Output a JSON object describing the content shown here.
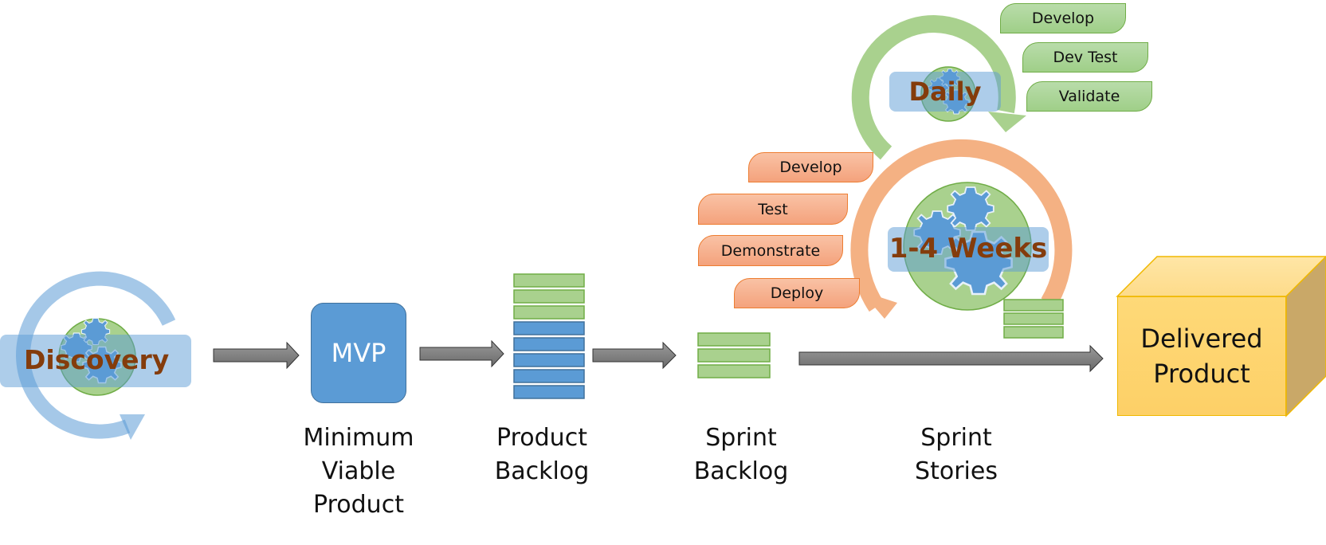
{
  "diagram": {
    "discovery": {
      "label": "Discovery"
    },
    "mvp": {
      "box_label": "MVP",
      "caption": [
        "Minimum",
        "Viable",
        "Product"
      ]
    },
    "product_backlog": {
      "caption": [
        "Product",
        "Backlog"
      ],
      "green_items": 3,
      "blue_items": 5
    },
    "sprint_backlog": {
      "caption": [
        "Sprint",
        "Backlog"
      ],
      "items": 3
    },
    "sprint_stories": {
      "caption": [
        "Sprint",
        "Stories"
      ],
      "items": 3
    },
    "daily_cycle": {
      "label": "Daily",
      "steps": [
        "Develop",
        "Dev Test",
        "Validate"
      ]
    },
    "sprint_cycle": {
      "label": "1-4 Weeks",
      "steps": [
        "Develop",
        "Test",
        "Demonstrate",
        "Deploy"
      ]
    },
    "delivered": {
      "label": [
        "Delivered",
        "Product"
      ]
    },
    "colors": {
      "blue": "#5b9bd5",
      "green": "#a9d18e",
      "orange": "#f4b183",
      "gold": "#ffd966",
      "arrow_gray": "#7f7f7f",
      "label_brown": "#843c0c"
    }
  }
}
